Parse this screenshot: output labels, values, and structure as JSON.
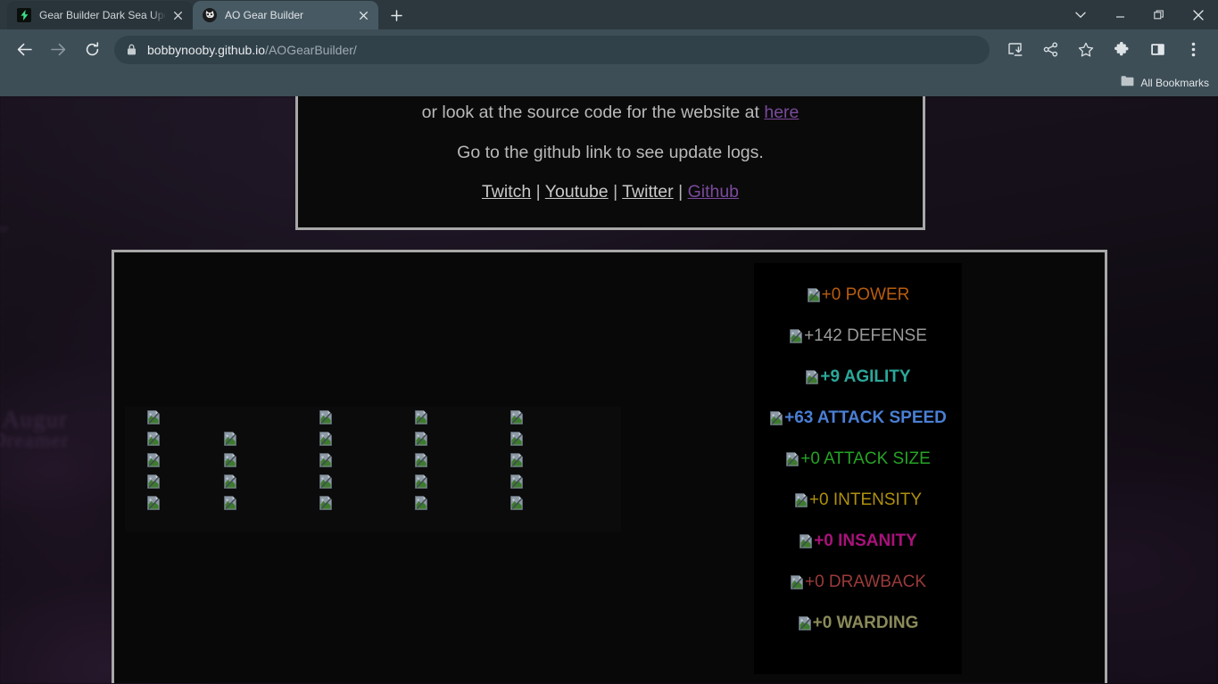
{
  "browser": {
    "tabs": [
      {
        "title": "Gear Builder Dark Sea Update Ho",
        "favicon": "lightning-bolt-icon",
        "active": false
      },
      {
        "title": "AO Gear Builder",
        "favicon": "cat-face-icon",
        "active": true
      }
    ],
    "new_tab_label": "+",
    "nav": {
      "back": "back-arrow-icon",
      "forward": "forward-arrow-icon",
      "reload": "reload-icon"
    },
    "omnibox": {
      "lock": "lock-icon",
      "domain": "bobbynooby.github.io",
      "path": "/AOGearBuilder/"
    },
    "toolbar_icons": [
      "install-icon",
      "share-icon",
      "bookmark-star-icon",
      "extensions-puzzle-icon",
      "side-panel-icon",
      "three-dot-menu-icon"
    ],
    "window_controls": [
      "tab-search-chevron",
      "minimize",
      "maximize-restore",
      "close"
    ],
    "bookmarks_bar": {
      "folder_icon": "folder-icon",
      "label": "All Bookmarks"
    }
  },
  "page": {
    "info_panel": {
      "line1_prefix": "or look at the source code for the website at ",
      "line1_link": "here",
      "line2": "Go to the github link to see update logs.",
      "social_links": [
        "Twitch",
        "Youtube",
        "Twitter",
        "Github"
      ],
      "separator": "|"
    },
    "gear_grid": {
      "columns": 5,
      "rows": 5,
      "broken_icon": "broken-image-icon",
      "missing_cells": [
        [
          0,
          1
        ]
      ]
    },
    "stats": [
      {
        "value": "+0",
        "label": "POWER",
        "color": "#b85c0e",
        "bold": false
      },
      {
        "value": "+142",
        "label": "DEFENSE",
        "color": "#9a9a9a",
        "bold": false
      },
      {
        "value": "+9",
        "label": "AGILITY",
        "color": "#2ba89a",
        "bold": true
      },
      {
        "value": "+63",
        "label": "ATTACK SPEED",
        "color": "#4a7fd4",
        "bold": true
      },
      {
        "value": "+0",
        "label": "ATTACK SIZE",
        "color": "#25a325",
        "bold": false
      },
      {
        "value": "+0",
        "label": "INTENSITY",
        "color": "#b0900e",
        "bold": false
      },
      {
        "value": "+0",
        "label": "INSANITY",
        "color": "#a8127a",
        "bold": true
      },
      {
        "value": "+0",
        "label": "DRAWBACK",
        "color": "#9a3a3a",
        "bold": false
      },
      {
        "value": "+0",
        "label": "WARDING",
        "color": "#8a8a5a",
        "bold": true
      }
    ]
  },
  "colors": {
    "chrome_tabstrip": "#2c383e",
    "chrome_toolbar": "#3d4e57",
    "active_tab": "#475a64",
    "panel_border": "#a8a8a8",
    "panel_bg": "#0a0a0a",
    "visited_link": "#7a4a9c"
  }
}
